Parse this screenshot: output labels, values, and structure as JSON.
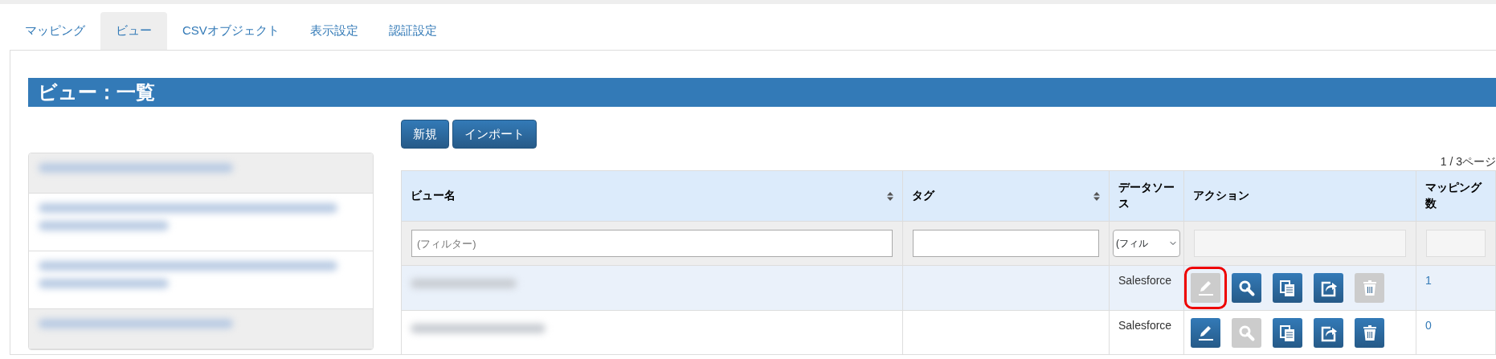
{
  "tabs": [
    {
      "label": "マッピング",
      "selected": false
    },
    {
      "label": "ビュー",
      "selected": true
    },
    {
      "label": "CSVオブジェクト",
      "selected": false
    },
    {
      "label": "表示設定",
      "selected": false
    },
    {
      "label": "認証設定",
      "selected": false
    }
  ],
  "page_title": "ビュー：一覧",
  "sidebar": {
    "items": [
      {
        "kind": "header"
      },
      {
        "kind": "link"
      },
      {
        "kind": "link"
      },
      {
        "kind": "footer"
      }
    ]
  },
  "toolbar_buttons": [
    "新規",
    "インポート"
  ],
  "pager": "1 / 3ページ",
  "table": {
    "columns": [
      {
        "label": "ビュー名",
        "sortable": true,
        "filter": {
          "kind": "text",
          "placeholder": "(フィルター)"
        }
      },
      {
        "label": "タグ",
        "sortable": true,
        "filter": {
          "kind": "text"
        }
      },
      {
        "label": "データソース",
        "sortable": false,
        "filter": {
          "kind": "select",
          "value": "(フィル"
        }
      },
      {
        "label": "アクション",
        "sortable": false,
        "filter": {
          "kind": "disabled"
        }
      },
      {
        "label": "マッピング数",
        "sortable": false,
        "filter": {
          "kind": "disabled"
        }
      }
    ],
    "rows": [
      {
        "selected": true,
        "data_source": "Salesforce",
        "mapping_count": "1",
        "actions": [
          {
            "kind": "edit",
            "disabled": true,
            "outlined": true
          },
          {
            "kind": "view",
            "disabled": false,
            "outlined": false
          },
          {
            "kind": "copy",
            "disabled": false,
            "outlined": false
          },
          {
            "kind": "export",
            "disabled": false,
            "outlined": false
          },
          {
            "kind": "delete",
            "disabled": true,
            "outlined": false
          }
        ]
      },
      {
        "selected": false,
        "data_source": "Salesforce",
        "mapping_count": "0",
        "actions": [
          {
            "kind": "edit",
            "disabled": false,
            "outlined": false
          },
          {
            "kind": "view",
            "disabled": true,
            "outlined": false
          },
          {
            "kind": "copy",
            "disabled": false,
            "outlined": false
          },
          {
            "kind": "export",
            "disabled": false,
            "outlined": false
          },
          {
            "kind": "delete",
            "disabled": false,
            "outlined": false
          }
        ]
      }
    ]
  }
}
